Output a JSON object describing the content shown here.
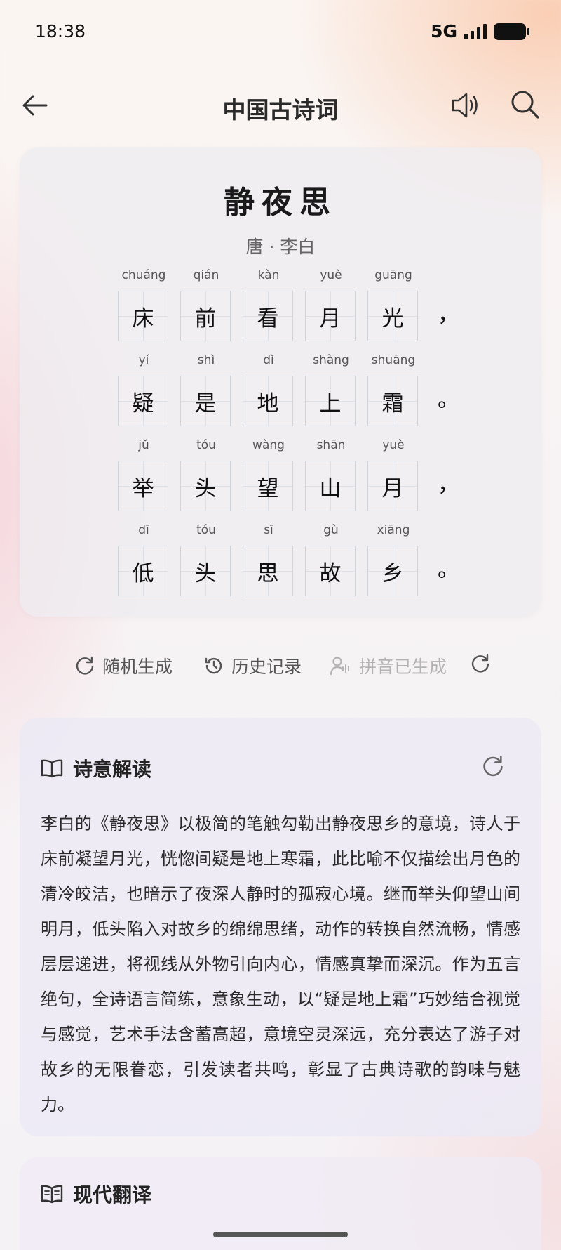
{
  "status_bar": {
    "time": "18:38",
    "network": "5G"
  },
  "header": {
    "title": "中国古诗词"
  },
  "poem": {
    "title": "静夜思",
    "author": "唐 · 李白",
    "lines": [
      {
        "chars": [
          {
            "pinyin": "chuáng",
            "char": "床"
          },
          {
            "pinyin": "qián",
            "char": "前"
          },
          {
            "pinyin": "kàn",
            "char": "看"
          },
          {
            "pinyin": "yuè",
            "char": "月"
          },
          {
            "pinyin": "guāng",
            "char": "光"
          }
        ],
        "punct": "，"
      },
      {
        "chars": [
          {
            "pinyin": "yí",
            "char": "疑"
          },
          {
            "pinyin": "shì",
            "char": "是"
          },
          {
            "pinyin": "dì",
            "char": "地"
          },
          {
            "pinyin": "shàng",
            "char": "上"
          },
          {
            "pinyin": "shuāng",
            "char": "霜"
          }
        ],
        "punct": "。"
      },
      {
        "chars": [
          {
            "pinyin": "jǔ",
            "char": "举"
          },
          {
            "pinyin": "tóu",
            "char": "头"
          },
          {
            "pinyin": "wàng",
            "char": "望"
          },
          {
            "pinyin": "shān",
            "char": "山"
          },
          {
            "pinyin": "yuè",
            "char": "月"
          }
        ],
        "punct": "，"
      },
      {
        "chars": [
          {
            "pinyin": "dī",
            "char": "低"
          },
          {
            "pinyin": "tóu",
            "char": "头"
          },
          {
            "pinyin": "sī",
            "char": "思"
          },
          {
            "pinyin": "gù",
            "char": "故"
          },
          {
            "pinyin": "xiāng",
            "char": "乡"
          }
        ],
        "punct": "。"
      }
    ]
  },
  "actions": {
    "random_label": "随机生成",
    "history_label": "历史记录",
    "pinyin_label": "拼音已生成"
  },
  "interpretation": {
    "title": "诗意解读",
    "text": "李白的《静夜思》以极简的笔触勾勒出静夜思乡的意境，诗人于床前凝望月光，恍惚间疑是地上寒霜，此比喻不仅描绘出月色的清冷皎洁，也暗示了夜深人静时的孤寂心境。继而举头仰望山间明月，低头陷入对故乡的绵绵思绪，动作的转换自然流畅，情感层层递进，将视线从外物引向内心，情感真挚而深沉。作为五言绝句，全诗语言简练，意象生动，以“疑是地上霜”巧妙结合视觉与感觉，艺术手法含蓄高超，意境空灵深远，充分表达了游子对故乡的无限眷恋，引发读者共鸣，彰显了古典诗歌的韵味与魅力。"
  },
  "translation": {
    "title": "现代翻译"
  },
  "icons": {
    "back": "arrow-left-icon",
    "speaker": "speaker-icon",
    "search": "search-icon",
    "random": "refresh-icon",
    "history": "history-icon",
    "pinyin": "user-voice-icon",
    "regenerate": "refresh-icon",
    "interpretation": "book-icon",
    "translation": "book-text-icon"
  }
}
